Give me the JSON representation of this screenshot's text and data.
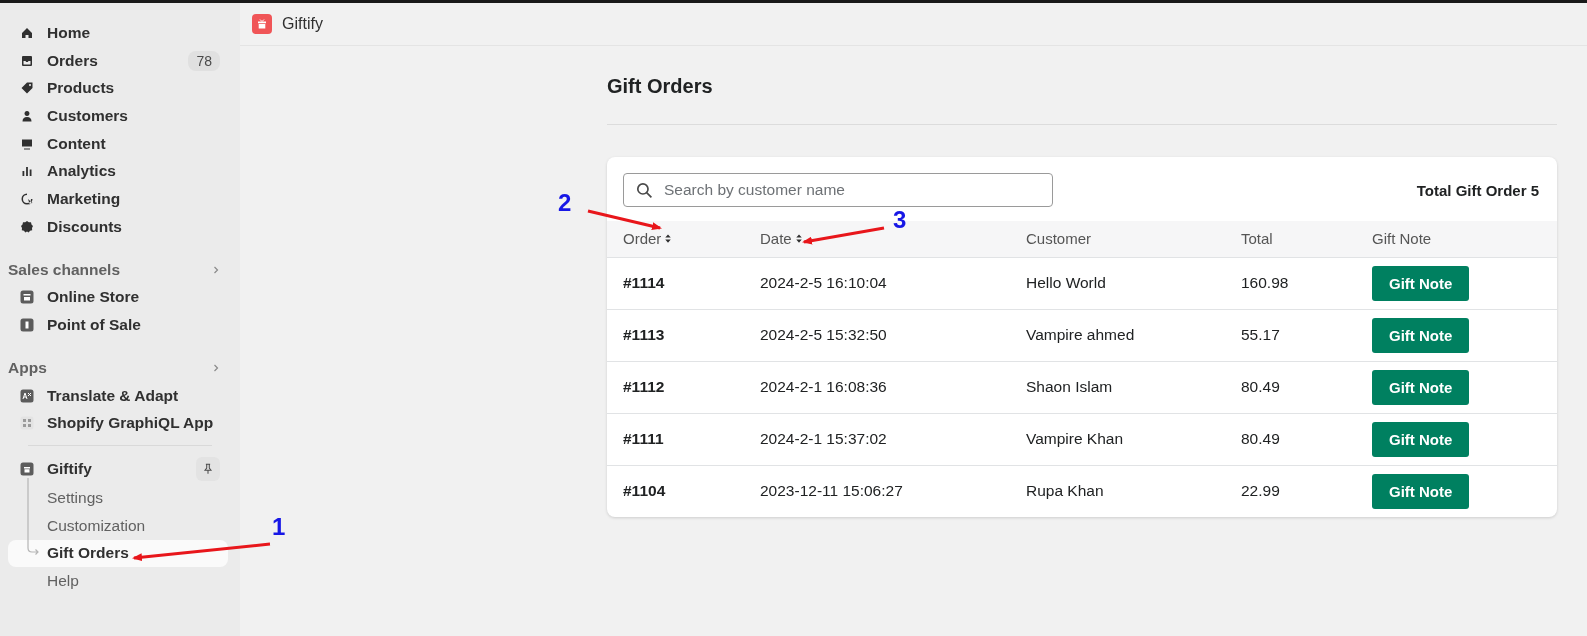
{
  "sidebar": {
    "main_items": [
      {
        "label": "Home",
        "selected": false
      },
      {
        "label": "Orders",
        "badge": "78",
        "selected": false
      },
      {
        "label": "Products",
        "selected": false
      },
      {
        "label": "Customers",
        "selected": false
      },
      {
        "label": "Content",
        "selected": false
      },
      {
        "label": "Analytics",
        "selected": false
      },
      {
        "label": "Marketing",
        "selected": false
      },
      {
        "label": "Discounts",
        "selected": false
      }
    ],
    "sections": [
      {
        "title": "Sales channels",
        "items": [
          {
            "label": "Online Store",
            "selected": false
          },
          {
            "label": "Point of Sale",
            "selected": false
          }
        ]
      },
      {
        "title": "Apps",
        "items": [
          {
            "label": "Translate & Adapt",
            "selected": false
          },
          {
            "label": "Shopify GraphiQL App",
            "selected": false
          }
        ]
      }
    ],
    "pinned_app": {
      "label": "Giftify",
      "children": [
        {
          "label": "Settings",
          "selected": false
        },
        {
          "label": "Customization",
          "selected": false
        },
        {
          "label": "Gift Orders",
          "selected": true
        },
        {
          "label": "Help",
          "selected": false
        }
      ]
    }
  },
  "header": {
    "app_name": "Giftify"
  },
  "page": {
    "title": "Gift Orders",
    "search": {
      "placeholder": "Search by customer name"
    },
    "total": "Total Gift Order 5",
    "table": {
      "columns": [
        {
          "label": "Order",
          "sortable": true
        },
        {
          "label": "Date",
          "sortable": true
        },
        {
          "label": "Customer",
          "sortable": false
        },
        {
          "label": "Total",
          "sortable": false
        },
        {
          "label": "Gift Note",
          "sortable": false
        }
      ],
      "rows": [
        {
          "order": "#1114",
          "date": "2024-2-5 16:10:04",
          "customer": "Hello World",
          "total": "160.98",
          "action": "Gift Note"
        },
        {
          "order": "#1113",
          "date": "2024-2-5 15:32:50",
          "customer": "Vampire ahmed",
          "total": "55.17",
          "action": "Gift Note"
        },
        {
          "order": "#1112",
          "date": "2024-2-1 16:08:36",
          "customer": "Shaon Islam",
          "total": "80.49",
          "action": "Gift Note"
        },
        {
          "order": "#1111",
          "date": "2024-2-1 15:37:02",
          "customer": "Vampire Khan",
          "total": "80.49",
          "action": "Gift Note"
        },
        {
          "order": "#1104",
          "date": "2023-12-11 15:06:27",
          "customer": "Rupa Khan",
          "total": "22.99",
          "action": "Gift Note"
        }
      ]
    }
  },
  "annotations": [
    {
      "label": "1"
    },
    {
      "label": "2"
    },
    {
      "label": "3"
    }
  ]
}
